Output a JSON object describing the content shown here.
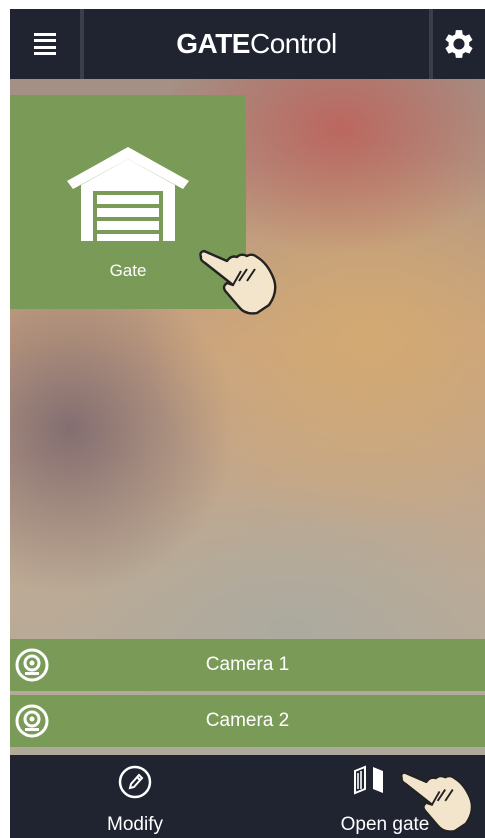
{
  "header": {
    "title_bold": "GATE",
    "title_light": "Control"
  },
  "tile": {
    "label": "Gate"
  },
  "cameras": [
    {
      "label": "Camera 1"
    },
    {
      "label": "Camera 2"
    }
  ],
  "bottom": {
    "modify_label": "Modify",
    "open_gate_label": "Open gate"
  },
  "colors": {
    "bar": "#1f2430",
    "tile": "#7a9a57"
  }
}
